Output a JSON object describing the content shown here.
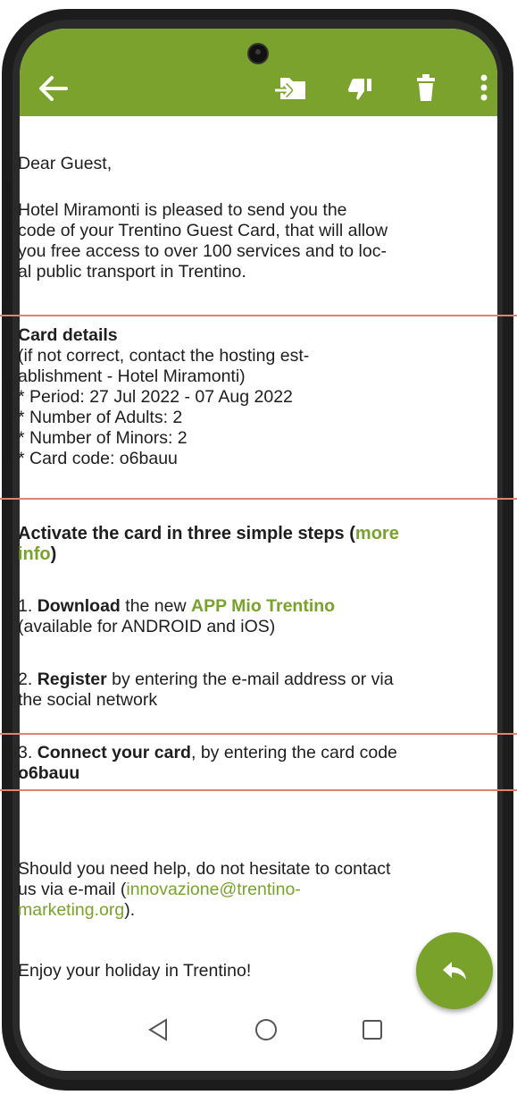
{
  "colors": {
    "accent": "#7aa22c",
    "link": "#78a22a",
    "separator": "#e0836f"
  },
  "appbar": {
    "icons": [
      "back-arrow-icon",
      "move-to-folder-icon",
      "thumbs-down-icon",
      "delete-icon",
      "more-vertical-icon"
    ]
  },
  "email": {
    "greeting": "Dear Guest,",
    "intro": [
      "Hotel Miramonti is pleased to send you the",
      "code of your Trentino Guest Card, that will allow",
      "you free access to over 100 services and to loc-",
      "al public transport in Trentino."
    ],
    "card_details": {
      "heading": "Card details",
      "note_line1": "(if not correct, contact the hosting est-",
      "note_line2": "ablishment - Hotel Miramonti)",
      "period": "* Period: 27 Jul 2022 - 07 Aug 2022",
      "adults": "* Number of Adults: 2",
      "minors": "* Number of Minors: 2",
      "code": "* Card code: o6bauu"
    },
    "activate": {
      "heading": "Activate the card in three simple steps (",
      "more_info_line1": "more",
      "more_info_line2": "info",
      "heading_end": ")"
    },
    "step1": {
      "num": "1. ",
      "bold": "Download",
      "text": " the new ",
      "app_link": "APP Mio Trentino",
      "line2": "(available for ANDROID and iOS)"
    },
    "step2": {
      "num": "2. ",
      "bold": "Register",
      "text": " by entering the e-mail address or via",
      "line2": "the social network"
    },
    "step3": {
      "num": "3. ",
      "bold": "Connect your card",
      "text": ", by entering the card code",
      "code": "o6bauu"
    },
    "help": {
      "line1": "Should you need help, do not hesitate to contact",
      "line2_pre": "us via e-mail (",
      "email_line1": "innovazione@trentino-",
      "email_line2": "marketing.org",
      "line3_post": ")."
    },
    "closing": "Enjoy your holiday in Trentino!"
  },
  "fab": {
    "icon": "reply-icon"
  },
  "navbar": {
    "icons": [
      "back-triangle-icon",
      "home-circle-icon",
      "recents-square-icon"
    ]
  }
}
